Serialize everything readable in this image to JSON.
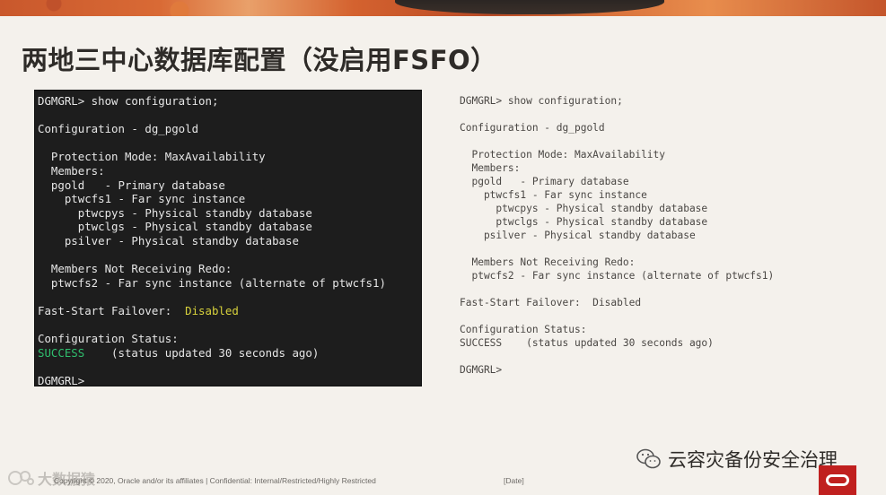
{
  "slide": {
    "title": "两地三中心数据库配置（没启用FSFO）"
  },
  "terminal": {
    "lines": [
      "DGMGRL> show configuration;",
      "",
      "Configuration - dg_pgold",
      "",
      "  Protection Mode: MaxAvailability",
      "  Members:",
      "  pgold   - Primary database",
      "    ptwcfs1 - Far sync instance",
      "      ptwcpys - Physical standby database",
      "      ptwclgs - Physical standby database",
      "    psilver - Physical standby database",
      "",
      "  Members Not Receiving Redo:",
      "  ptwcfs2 - Far sync instance (alternate of ptwcfs1)",
      "",
      "Fast-Start Failover:  ",
      "",
      "Configuration Status:",
      "",
      "",
      "DGMGRL>"
    ],
    "failover_status": "Disabled",
    "status_word": "SUCCESS",
    "status_detail": "    (status updated 30 seconds ago)"
  },
  "plain": {
    "lines": [
      "DGMGRL> show configuration;",
      "",
      "Configuration - dg_pgold",
      "",
      "  Protection Mode: MaxAvailability",
      "  Members:",
      "  pgold   - Primary database",
      "    ptwcfs1 - Far sync instance",
      "      ptwcpys - Physical standby database",
      "      ptwclgs - Physical standby database",
      "    psilver - Physical standby database",
      "",
      "  Members Not Receiving Redo:",
      "  ptwcfs2 - Far sync instance (alternate of ptwcfs1)",
      "",
      "Fast-Start Failover:  Disabled",
      "",
      "Configuration Status:",
      "SUCCESS    (status updated 30 seconds ago)",
      "",
      "DGMGRL>"
    ]
  },
  "footer": {
    "watermark": "大数据猿",
    "copyright": "Copyright © 2020, Oracle and/or its affiliates  |  Confidential: Internal/Restricted/Highly Restricted",
    "date": "[Date]",
    "wechat_account": "云容灾备份安全治理"
  },
  "colors": {
    "terminal_bg": "#1d1d1d",
    "failover_highlight": "#d8d23c",
    "success_highlight": "#2fbf6e",
    "oracle_red": "#c0201f"
  },
  "icons": [
    "wechat-icon",
    "oracle-logo-icon",
    "watermark-logo-icon"
  ]
}
